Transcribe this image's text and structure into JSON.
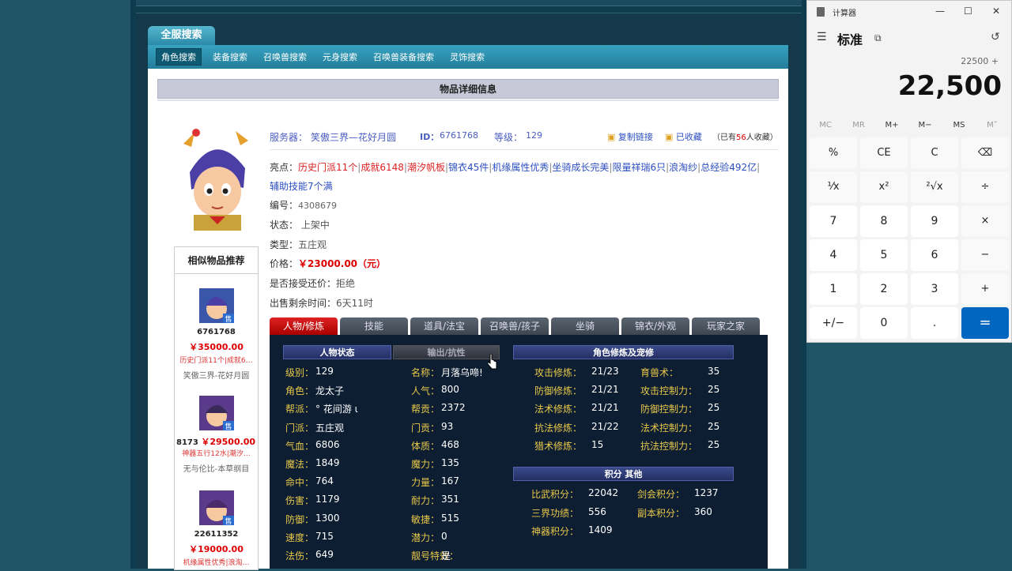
{
  "site": {
    "search_tab": "全服搜索",
    "nav": [
      "角色搜索",
      "装备搜索",
      "召唤兽搜索",
      "元身搜索",
      "召唤兽装备搜索",
      "灵饰搜索"
    ],
    "page_title": "物品详细信息"
  },
  "item": {
    "server_label": "服务器：",
    "server": "笑傲三界—花好月圆",
    "id_label": "ID：",
    "id": "6761768",
    "level_label": "等级：",
    "level": "129",
    "copy_link": "复制链接",
    "collected": "已收藏",
    "fav_prefix": "（已有",
    "fav_count": "56",
    "fav_suffix": "人收藏）",
    "highlights_label": "亮点：",
    "highlights": [
      "历史门派11个",
      "成就6148",
      "潮汐帆板",
      "锦衣45件",
      "机缘属性优秀",
      "坐骑成长完美",
      "限量祥瑞6只",
      "浪淘纱",
      "总经验492亿",
      "辅助技能7个满"
    ],
    "serial_label": "编号：",
    "serial": "4308679",
    "status_label": "状态：",
    "status": "上架中",
    "type_label": "类型：",
    "type": "五庄观",
    "price_label": "价格：",
    "price": "￥23000.00（元）",
    "bargain_label": "是否接受还价：",
    "bargain": "拒绝",
    "time_label": "出售剩余时间：",
    "time": "6天11时"
  },
  "similar": {
    "title": "相似物品推荐",
    "badge": "售",
    "items": [
      {
        "id": "6761768",
        "price": "￥35000.00",
        "desc": "历史门派11个|成就6…",
        "server": "笑傲三界-花好月圆"
      },
      {
        "id": "8173",
        "price": "￥29500.00",
        "desc": "神器五行12水|潮汐…",
        "server": "无与伦比-本草纲目"
      },
      {
        "id": "22611352",
        "price": "￥19000.00",
        "desc": "机缘属性优秀|浪淘…",
        "server": ""
      }
    ]
  },
  "tabs": [
    "人物/修炼",
    "技能",
    "道具/法宝",
    "召唤兽/孩子",
    "坐骑",
    "锦衣/外观",
    "玩家之家"
  ],
  "stats": {
    "head_status": "人物状态",
    "head_resist": "输出/抗性",
    "head_cult": "角色修炼及宠修",
    "head_score": "积分 其他",
    "col1": [
      [
        "级别：",
        "129"
      ],
      [
        "角色：",
        "龙太子"
      ],
      [
        "帮派：",
        "° 花间游 ι"
      ],
      [
        "门派：",
        "五庄观"
      ],
      [
        "气血：",
        "6806"
      ],
      [
        "魔法：",
        "1849"
      ],
      [
        "命中：",
        "764"
      ],
      [
        "伤害：",
        "1179"
      ],
      [
        "防御：",
        "1300"
      ],
      [
        "速度：",
        "715"
      ],
      [
        "法伤：",
        "649"
      ]
    ],
    "col2": [
      [
        "名称：",
        "月落乌啼!"
      ],
      [
        "人气：",
        "800"
      ],
      [
        "帮贡：",
        "2372"
      ],
      [
        "门贡：",
        "93"
      ],
      [
        "体质：",
        "468"
      ],
      [
        "魔力：",
        "135"
      ],
      [
        "力量：",
        "167"
      ],
      [
        "耐力：",
        "351"
      ],
      [
        "敏捷：",
        "515"
      ],
      [
        "潜力：",
        "0"
      ],
      [
        "靓号特效：",
        "是"
      ]
    ],
    "cult1": [
      [
        "攻击修炼：",
        "21/23"
      ],
      [
        "防御修炼：",
        "21/21"
      ],
      [
        "法术修炼：",
        "21/21"
      ],
      [
        "抗法修炼：",
        "21/22"
      ],
      [
        "猎术修炼：",
        "15"
      ]
    ],
    "cult2": [
      [
        "育兽术：",
        "35"
      ],
      [
        "攻击控制力：",
        "25"
      ],
      [
        "防御控制力：",
        "25"
      ],
      [
        "法术控制力：",
        "25"
      ],
      [
        "抗法控制力：",
        "25"
      ]
    ],
    "score1": [
      [
        "比武积分：",
        "22042"
      ],
      [
        "三界功绩：",
        "556"
      ],
      [
        "神器积分：",
        "1409"
      ]
    ],
    "score2": [
      [
        "剑会积分：",
        "1237"
      ],
      [
        "副本积分：",
        "360"
      ]
    ]
  },
  "calculator": {
    "title": "计算器",
    "mode": "标准",
    "expression": "22500 +",
    "display": "22,500",
    "memory": [
      "MC",
      "MR",
      "M+",
      "M−",
      "MS",
      "M˅"
    ],
    "keys": [
      [
        "%",
        "CE",
        "C",
        "⌫"
      ],
      [
        "¹⁄x",
        "x²",
        "²√x",
        "÷"
      ],
      [
        "7",
        "8",
        "9",
        "×"
      ],
      [
        "4",
        "5",
        "6",
        "−"
      ],
      [
        "1",
        "2",
        "3",
        "+"
      ],
      [
        "+/−",
        "0",
        ".",
        "="
      ]
    ]
  }
}
